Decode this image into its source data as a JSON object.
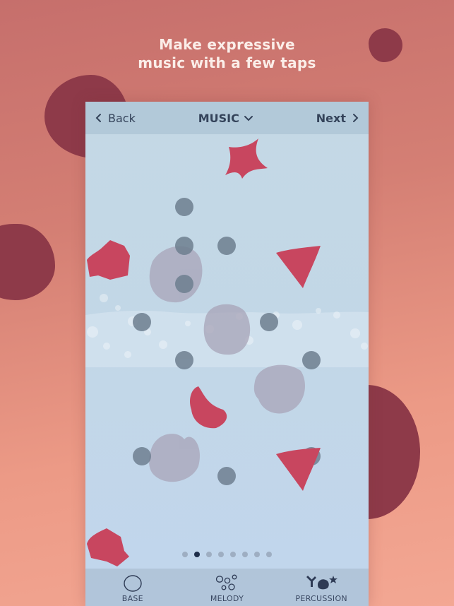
{
  "headline": {
    "line1": "Make expressive",
    "line2": "music with a few taps"
  },
  "colors": {
    "background_top": "#c66f6c",
    "background_bottom": "#f3a793",
    "blob": "#8e3a49",
    "shape_red": "#c8465f",
    "pebble_dark": "#6e7f90",
    "pebble_light": "#a8a6b6",
    "text_dark": "#34435a",
    "active_dot": "#1e2e4a"
  },
  "navbar": {
    "back_label": "Back",
    "back_icon": "chevron-left-icon",
    "title": "MUSIC",
    "title_icon": "chevron-down-icon",
    "next_label": "Next",
    "next_icon": "chevron-right-icon"
  },
  "pagination": {
    "total": 8,
    "active_index": 1
  },
  "tabs": [
    {
      "label": "BASE",
      "icon": "circle-outline-icon"
    },
    {
      "label": "MELODY",
      "icon": "bubbles-icon"
    },
    {
      "label": "PERCUSSION",
      "icon": "percussion-shapes-icon"
    }
  ],
  "canvas": {
    "red_shapes": [
      "star",
      "hexagon-left-top",
      "triangle-right-top",
      "crescent",
      "triangle-right-bottom",
      "hexagon-left-bottom"
    ],
    "pebble_count": 10,
    "large_stone_count": 4
  }
}
